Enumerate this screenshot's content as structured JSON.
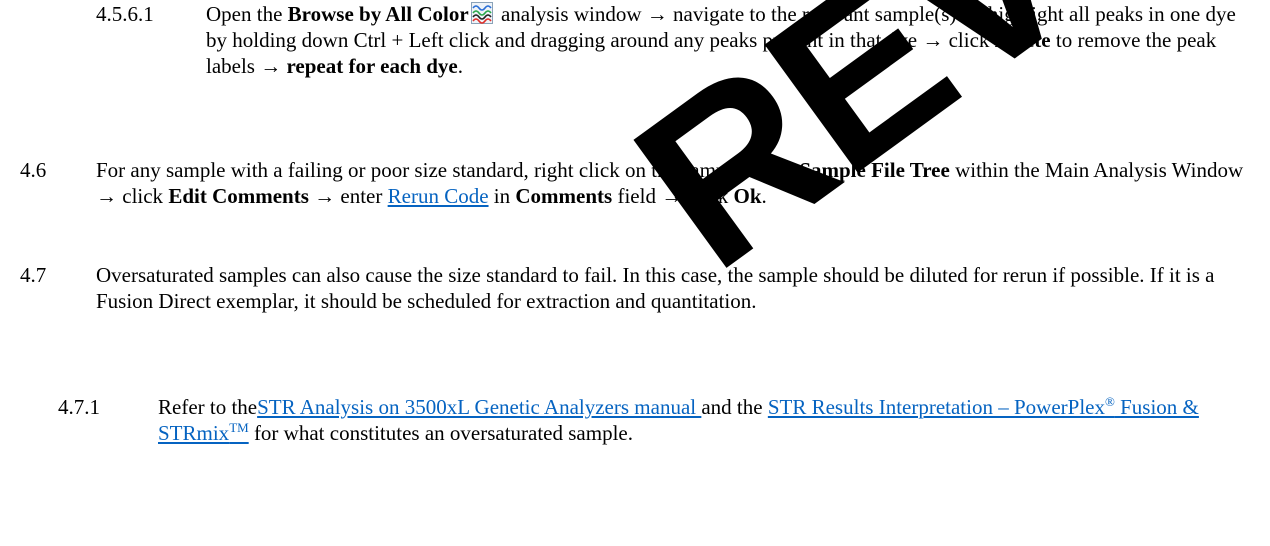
{
  "watermark": {
    "text": "REVIEWED",
    "color": "#000000"
  },
  "link_color": "#0563c1",
  "sections": {
    "s4561": {
      "number": "4.5.6.1",
      "t1": "Open the ",
      "b1": "Browse by All Color",
      "icon": "browse-by-all-color-icon",
      "t2": " analysis window → navigate to the relevant sample(s) → highlight all peaks in one dye by holding down Ctrl + Left click and dragging around any peaks present in that dye → click ",
      "b2": "Delete",
      "t3": " to remove the peak labels → ",
      "b3": "repeat for each dye",
      "t4": "."
    },
    "s46": {
      "number": "4.6",
      "t1": "For any sample with a failing or poor size standard, right click on the sample in the ",
      "b1": "Sample File Tree",
      "t2": " within the Main Analysis Window → click ",
      "b2": "Edit Comments",
      "t3": " → enter ",
      "link1": "Rerun Code",
      "t4": " in ",
      "b3": "Comments",
      "t5": " field → click ",
      "b4": "Ok",
      "t6": "."
    },
    "s47": {
      "number": "4.7",
      "text": "Oversaturated samples can also cause the size standard to fail. In this case, the sample should be diluted for rerun if possible. If it is a Fusion Direct exemplar, it should be scheduled for extraction and quantitation."
    },
    "s471": {
      "number": "4.7.1",
      "t1": "Refer to the",
      "link1": "STR Analysis on 3500xL Genetic Analyzers manual ",
      "t2": " and the ",
      "link2a": "STR Results Interpretation – PowerPlex",
      "link2_reg": "®",
      "link2b": " Fusion & STRmix",
      "link2_tm": "TM",
      "t3": " for what constitutes an oversaturated sample."
    }
  }
}
